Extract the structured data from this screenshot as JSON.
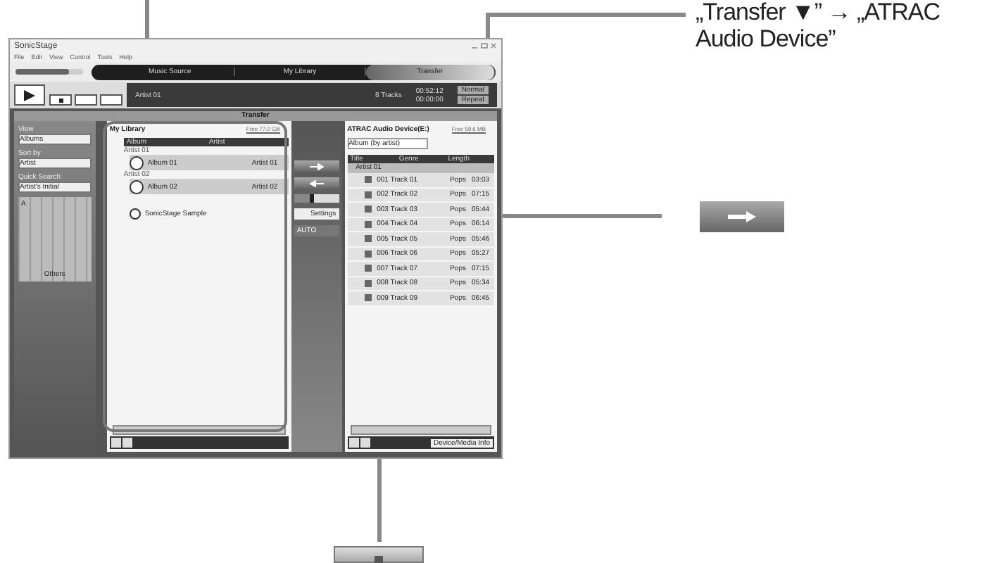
{
  "callout": {
    "text": "„Transfer ▼” → „ATRAC Audio Device”"
  },
  "window": {
    "title": "SonicStage"
  },
  "menu": [
    "File",
    "Edit",
    "View",
    "Control",
    "Tools",
    "Help"
  ],
  "volume": {
    "level": 0.8
  },
  "nav": [
    {
      "label": "Music Source",
      "selected": false
    },
    {
      "label": "My Library",
      "selected": false
    },
    {
      "label": "Transfer",
      "selected": true
    }
  ],
  "player": {
    "artist": "Artist 01",
    "tracks": "8 Tracks",
    "total": "00:52:12",
    "time": "00:00:00",
    "mode": "Normal",
    "repeat": "Repeat"
  },
  "transfer_title": "Transfer",
  "sidebar": {
    "fields": [
      {
        "label": "View",
        "value": "Albums"
      },
      {
        "label": "Sort by",
        "value": "Artist"
      },
      {
        "label": "Quick Search",
        "value": "Artist's Initial"
      }
    ],
    "grid_top": "A",
    "grid_label": "Others"
  },
  "library": {
    "title": "My Library",
    "free": "Free 77.0 GB",
    "columns": [
      "Album",
      "Artist"
    ],
    "groups": [
      {
        "name": "Artist 01",
        "albums": [
          {
            "title": "Album 01",
            "artist": "Artist 01"
          }
        ]
      },
      {
        "name": "Artist 02",
        "albums": [
          {
            "title": "Album 02",
            "artist": "Artist 02"
          }
        ]
      }
    ],
    "extra": "SonicStage Sample"
  },
  "middle": {
    "slider": {
      "level": 0.45
    },
    "settings": "Settings",
    "auto": "AUTO"
  },
  "device": {
    "title": "ATRAC Audio Device(E:)",
    "free": "Free 59.6 MB",
    "view": "Album (by artist)",
    "columns": [
      "Title",
      "Genre",
      "Length"
    ],
    "group": "Artist 01",
    "tracks": [
      {
        "title": "001 Track 01",
        "genre": "Pops",
        "length": "03:03"
      },
      {
        "title": "002 Track 02",
        "genre": "Pops",
        "length": "07:15"
      },
      {
        "title": "003 Track 03",
        "genre": "Pops",
        "length": "05:44"
      },
      {
        "title": "004 Track 04",
        "genre": "Pops",
        "length": "06:14"
      },
      {
        "title": "005 Track 05",
        "genre": "Pops",
        "length": "05:46"
      },
      {
        "title": "006 Track 06",
        "genre": "Pops",
        "length": "05:27"
      },
      {
        "title": "007 Track 07",
        "genre": "Pops",
        "length": "07:15"
      },
      {
        "title": "008 Track 08",
        "genre": "Pops",
        "length": "05:34"
      },
      {
        "title": "009 Track 09",
        "genre": "Pops",
        "length": "06:45"
      }
    ],
    "info_button": "Device/Media Info"
  }
}
